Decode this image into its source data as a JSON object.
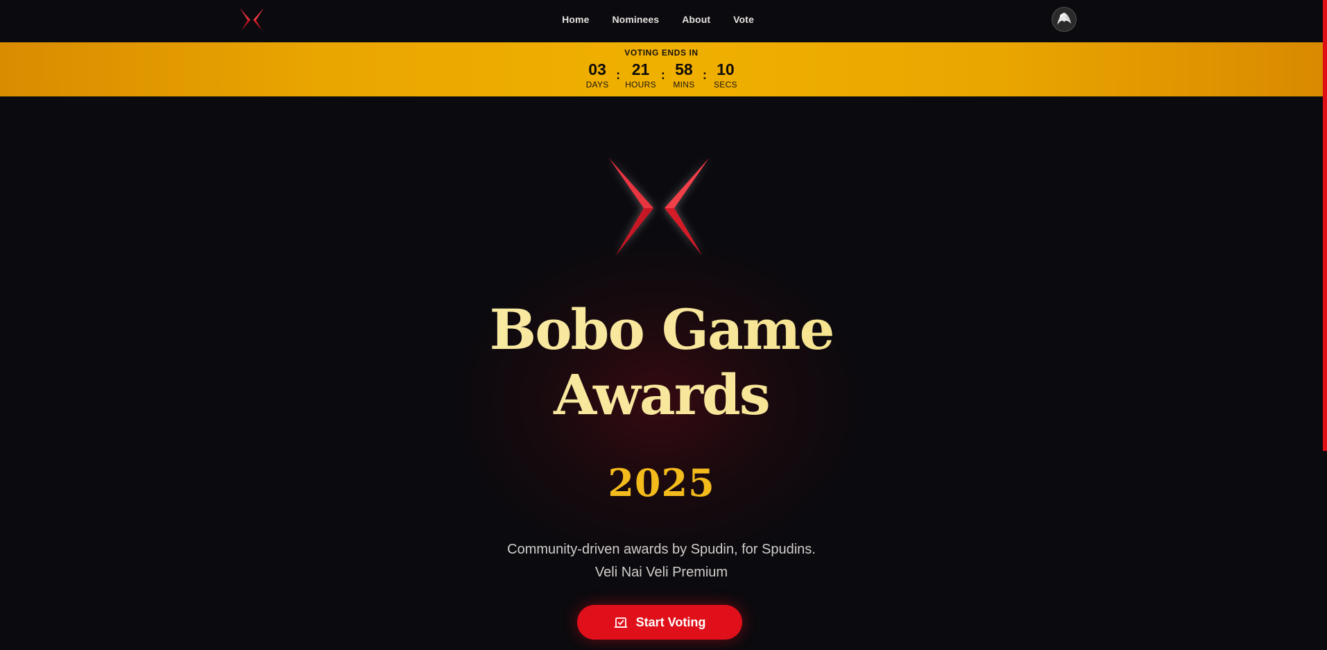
{
  "nav": {
    "logo_icon": "crossed-blades-logo-icon",
    "links": [
      {
        "label": "Home"
      },
      {
        "label": "Nominees"
      },
      {
        "label": "About"
      },
      {
        "label": "Vote"
      }
    ],
    "avatar_icon": "user-avatar-icon"
  },
  "countdown": {
    "title": "VOTING ENDS IN",
    "units": [
      {
        "value": "03",
        "label": "DAYS"
      },
      {
        "value": "21",
        "label": "HOURS"
      },
      {
        "value": "58",
        "label": "MINS"
      },
      {
        "value": "10",
        "label": "SECS"
      }
    ],
    "separator": ":"
  },
  "hero": {
    "logo_icon": "crossed-blades-emblem-icon",
    "title_lines": [
      "Bobo Game",
      "Awards"
    ],
    "year": "2025",
    "subtitle_lines": [
      "Community-driven awards by Spudin, for Spudins.",
      "Veli Nai Veli Premium"
    ],
    "cta_label": "Start Voting",
    "cta_icon": "ballot-check-icon"
  },
  "colors": {
    "background": "#0b0a0e",
    "accent_red": "#e0101a",
    "banner_gold": "#f0b000",
    "title_cream": "#f7e69a",
    "year_gold": "#f4bb1c"
  }
}
